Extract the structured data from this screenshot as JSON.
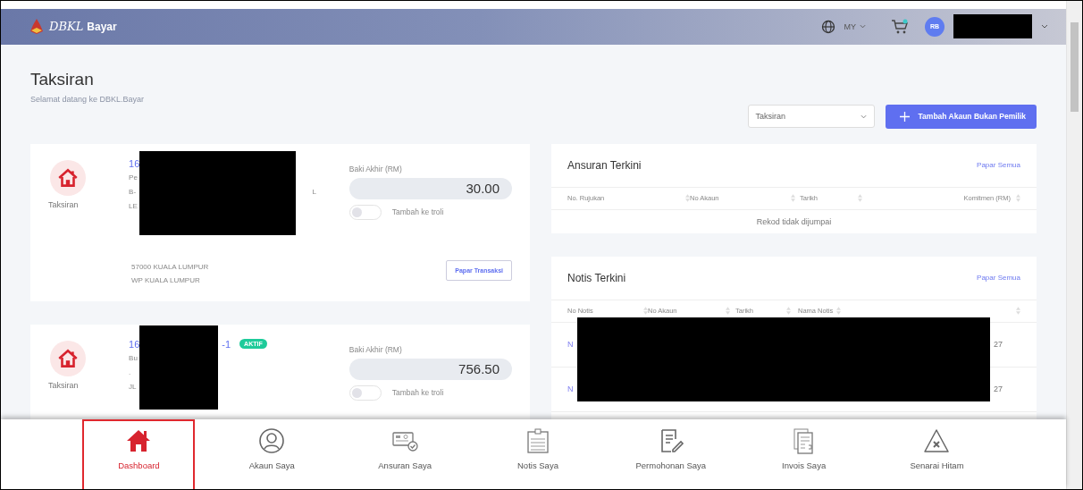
{
  "header": {
    "brand_script": "DBKL",
    "brand_word": "Bayar",
    "language": "MY",
    "avatar": "RB"
  },
  "page": {
    "title": "Taksiran",
    "subtitle": "Selamat datang ke DBKL.Bayar",
    "filter": {
      "value": "Taksiran"
    },
    "add_button": "Tambah Akaun Bukan Pemilik"
  },
  "accounts": [
    {
      "icon_label": "Taksiran",
      "number": "16",
      "lines": [
        "Pe",
        "B-",
        "LE"
      ],
      "line_tail": "L",
      "balance_label": "Baki Akhir (RM)",
      "balance": "30.00",
      "cart_toggle": {
        "label": "Tambah ke troli",
        "on": false
      },
      "address": [
        "57000 KUALA LUMPUR",
        "WP KUALA LUMPUR"
      ],
      "action": "Papar Transaksi"
    },
    {
      "icon_label": "Taksiran",
      "number": "16",
      "suffix": "-1",
      "badge": "AKTIF",
      "lines": [
        "Bu",
        ".",
        "JL"
      ],
      "balance_label": "Baki Akhir (RM)",
      "balance": "756.50",
      "cart_toggle": {
        "label": "Tambah ke troli",
        "on": false
      }
    }
  ],
  "ansuran": {
    "title": "Ansuran Terkini",
    "view_all": "Papar Semua",
    "columns": [
      "No. Rujukan",
      "No Akaun",
      "Tarikh",
      "Komitmen (RM)"
    ],
    "empty": "Rekod tidak dijumpai"
  },
  "notis": {
    "title": "Notis Terkini",
    "view_all": "Papar Semua",
    "columns": [
      "No Notis",
      "No Akaun",
      "Tarikh",
      "Nama Notis"
    ],
    "rows": [
      {
        "column_1": "N",
        "column_5": "27"
      },
      {
        "column_1": "N",
        "column_5": "27"
      }
    ]
  },
  "nav": [
    {
      "label": "Dashboard",
      "kind": "home",
      "selected": true
    },
    {
      "label": "Akaun Saya",
      "kind": "user",
      "selected": false
    },
    {
      "label": "Ansuran Saya",
      "kind": "card",
      "selected": false
    },
    {
      "label": "Notis Saya",
      "kind": "notice",
      "selected": false
    },
    {
      "label": "Permohonan Saya",
      "kind": "form",
      "selected": false
    },
    {
      "label": "Invois Saya",
      "kind": "invoice",
      "selected": false
    },
    {
      "label": "Senarai Hitam",
      "kind": "warning",
      "selected": false
    }
  ]
}
